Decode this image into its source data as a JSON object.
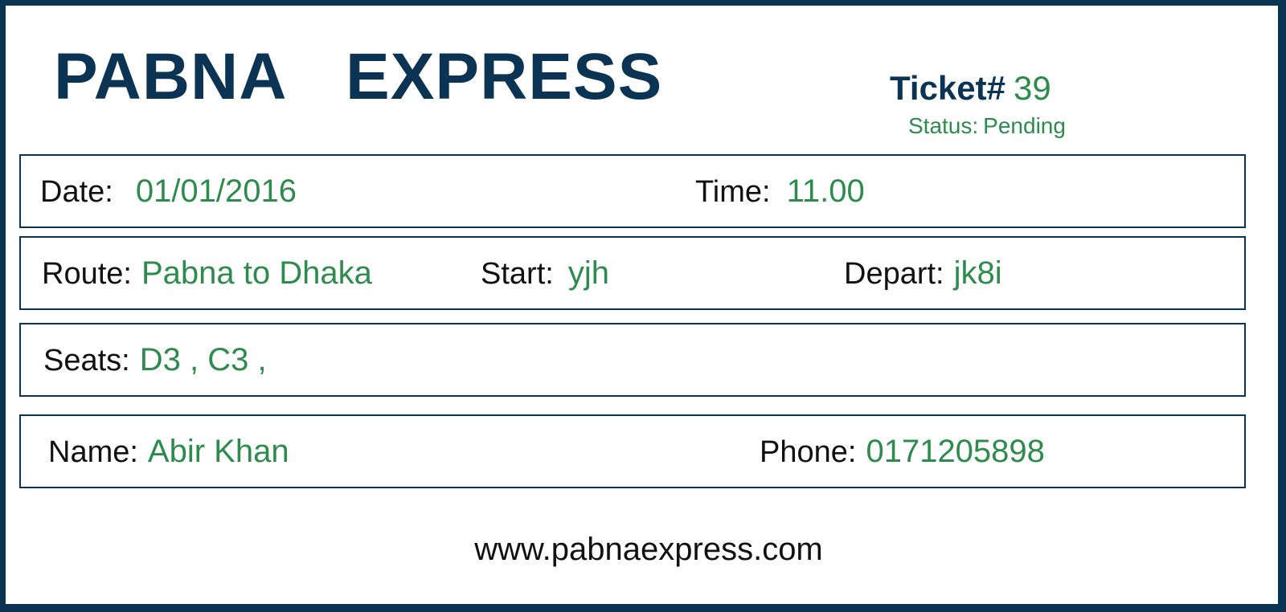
{
  "ticket": {
    "brand": "PABNA  EXPRESS",
    "ticket_label": "Ticket#",
    "ticket_number": "39",
    "status_label": "Status:",
    "status_value": "Pending"
  },
  "row1": {
    "date_label": "Date:",
    "date_value": "01/01/2016",
    "time_label": "Time:",
    "time_value": "11.00"
  },
  "row2": {
    "route_label": "Route:",
    "route_value": "Pabna to Dhaka",
    "start_label": "Start:",
    "start_value": "yjh",
    "depart_label": "Depart:",
    "depart_value": "jk8i"
  },
  "row3": {
    "seats_label": "Seats:",
    "seats_value": "D3 , C3 ,"
  },
  "row4": {
    "name_label": "Name:",
    "name_value": "Abir Khan",
    "phone_label": "Phone:",
    "phone_value": "0171205898"
  },
  "footer": {
    "website": "www.pabnaexpress.com"
  },
  "colors": {
    "brand_navy": "#0a3354",
    "value_green": "#2e8b4e",
    "label_black": "#111111"
  }
}
